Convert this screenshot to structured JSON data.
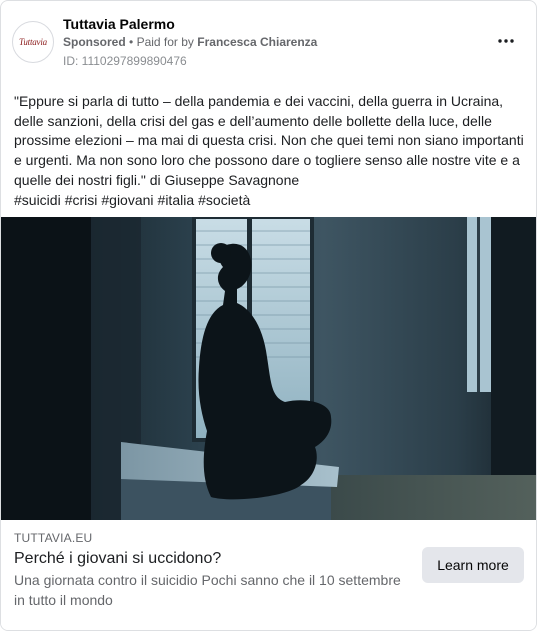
{
  "header": {
    "page_name": "Tuttavia Palermo",
    "avatar_text": "Tuttavia",
    "sponsored_label": "Sponsored",
    "separator": "•",
    "paid_for_prefix": "Paid for by",
    "paid_for_name": "Francesca Chiarenza",
    "ad_id": "ID: 1110297899890476",
    "more_icon": "more-horizontal-icon"
  },
  "post": {
    "text": "\"Eppure si parla di tutto – della pandemia e dei vaccini, della guerra in Ucraina, delle sanzioni, della crisi del gas e dell’aumento delle bollette della luce, delle prossime elezioni – ma mai di questa crisi. Non che quei temi non siano importanti e urgenti. Ma non sono loro che possono dare o togliere senso alle nostre vite e a quelle dei nostri figli.\" di Giuseppe Savagnone",
    "hashtags": [
      "#suicidi",
      "#crisi",
      "#giovani",
      "#italia",
      "#società"
    ]
  },
  "link_preview": {
    "domain": "TUTTAVIA.EU",
    "headline": "Perché i giovani si uccidono?",
    "description": "Una giornata contro il suicidio Pochi sanno che il 10 settembre in tutto il mondo",
    "cta_label": "Learn more"
  },
  "colors": {
    "text_primary": "#1c1e21",
    "text_secondary": "#65676b",
    "button_bg": "#e4e6eb",
    "border": "#dddfe2"
  }
}
